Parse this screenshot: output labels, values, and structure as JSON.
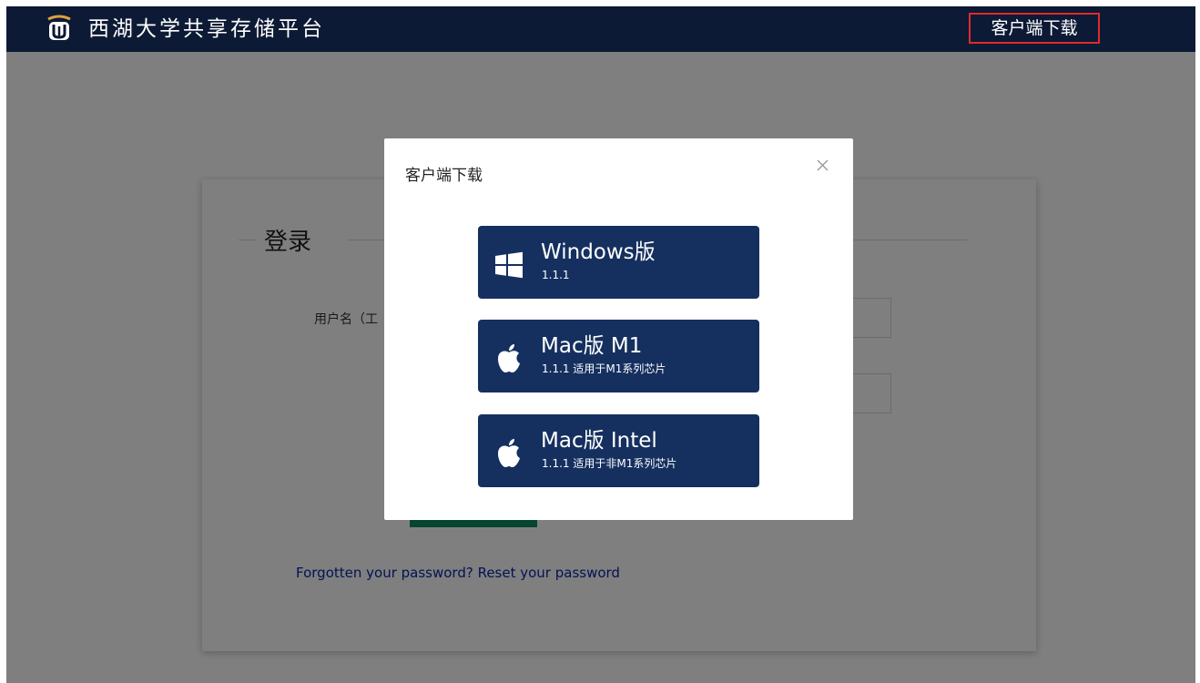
{
  "header": {
    "brand_title": "西湖大学共享存储平台",
    "download_link": "客户端下载",
    "logo_icon": "university-logo-icon"
  },
  "login": {
    "title": "登录",
    "username_label": "用户名（工",
    "forgot_text": "Forgotten your password? Reset your password"
  },
  "modal": {
    "title": "客户端下载",
    "close_icon": "close-icon",
    "buttons": [
      {
        "name": "Windows版",
        "sub": "1.1.1",
        "icon": "windows-icon"
      },
      {
        "name": "Mac版 M1",
        "sub": "1.1.1 适用于M1系列芯片",
        "icon": "apple-icon"
      },
      {
        "name": "Mac版 Intel",
        "sub": "1.1.1 适用于非M1系列芯片",
        "icon": "apple-icon"
      }
    ]
  },
  "colors": {
    "nav_bg": "#0d1a35",
    "button_bg": "#15305f",
    "highlight_border": "#e02a2a",
    "link": "#0a24a8"
  }
}
